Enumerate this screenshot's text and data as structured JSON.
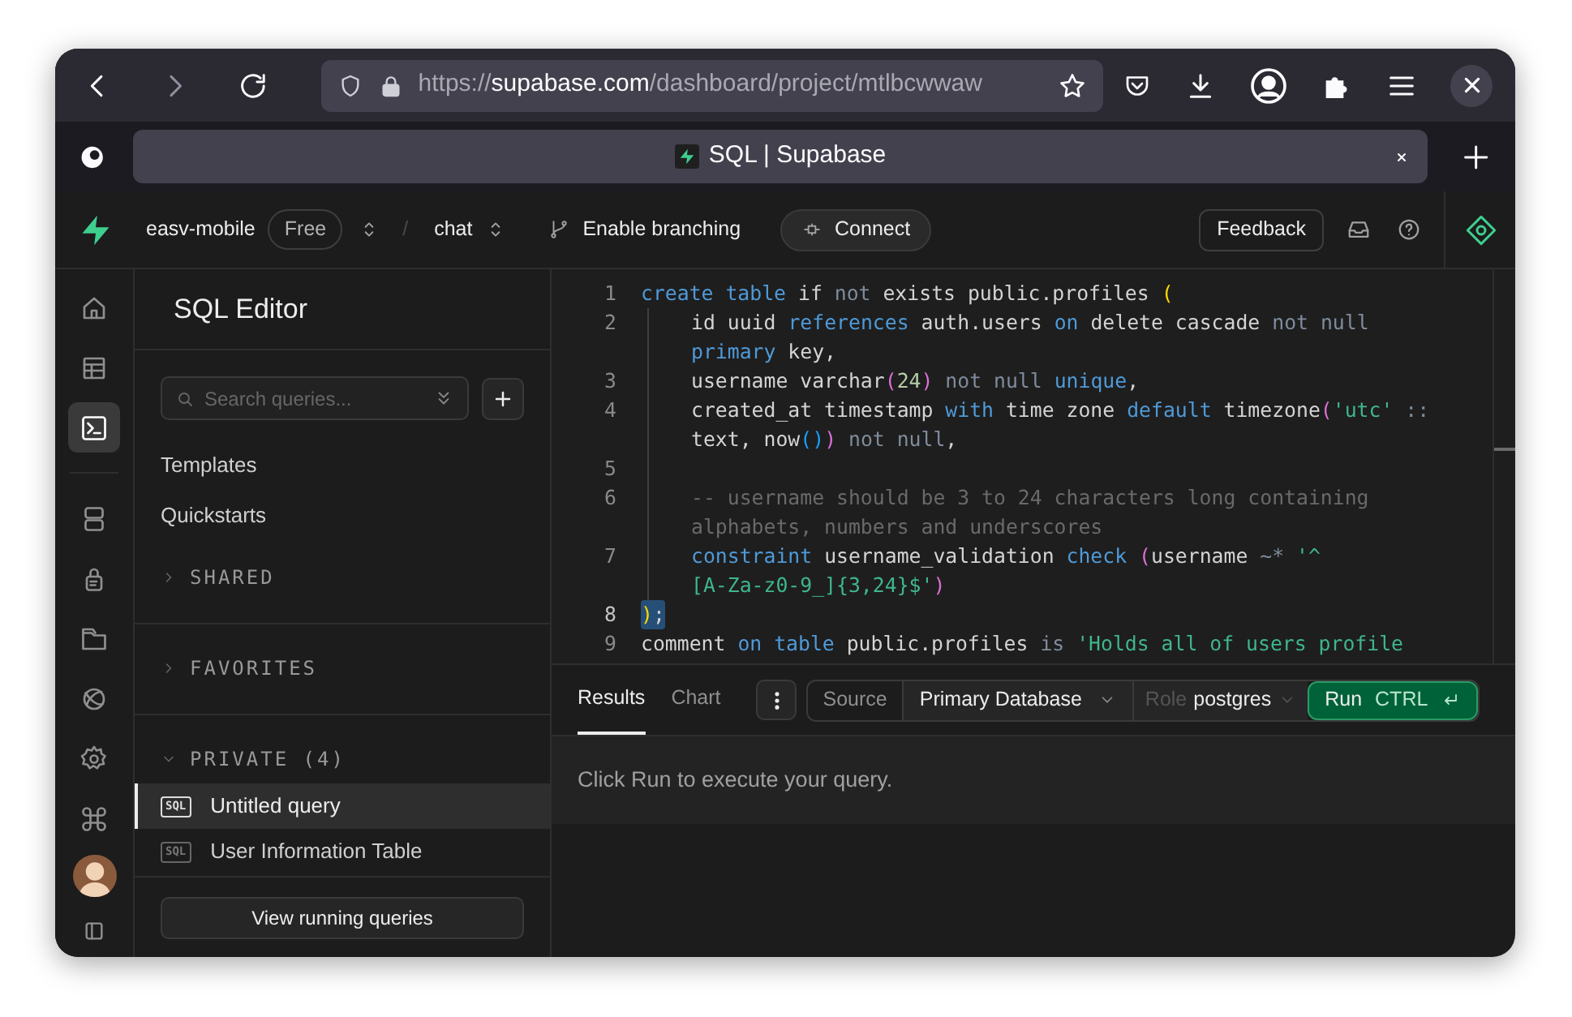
{
  "browser": {
    "url": {
      "scheme": "https://",
      "host": "supabase.com",
      "path": "/dashboard/project/mtlbcwwaw"
    },
    "tab": {
      "title": "SQL | Supabase"
    }
  },
  "header": {
    "project": "easv-mobile",
    "plan": "Free",
    "separator": "/",
    "branch": "chat",
    "branching": "Enable branching",
    "connect": "Connect",
    "feedback": "Feedback"
  },
  "rail_top": [
    {
      "kind": "home",
      "selected": false
    },
    {
      "kind": "table",
      "selected": false
    },
    {
      "kind": "terminal",
      "selected": true
    }
  ],
  "rail": [
    {
      "kind": "database",
      "selected": false
    },
    {
      "kind": "lock",
      "selected": false
    },
    {
      "kind": "folder",
      "selected": false
    },
    {
      "kind": "globe",
      "selected": false
    },
    {
      "kind": "gear",
      "selected": false
    },
    {
      "kind": "command",
      "selected": false
    }
  ],
  "sidebar": {
    "title": "SQL Editor",
    "search": {
      "placeholder": "Search queries..."
    },
    "links": [
      "Templates",
      "Quickstarts"
    ],
    "sections": [
      {
        "label": "SHARED",
        "expanded": false
      },
      {
        "label": "FAVORITES",
        "expanded": false
      },
      {
        "label": "PRIVATE (4)",
        "expanded": true,
        "items": [
          {
            "badge": "SQL",
            "name": "Untitled query",
            "selected": true
          },
          {
            "badge": "SQL",
            "name": "User Information Table",
            "selected": false
          }
        ]
      }
    ],
    "footer_button": "View running queries"
  },
  "editor": {
    "lines": [
      {
        "number": "1",
        "indented": false,
        "selected": false,
        "rows": [
          {
            "tokens": [
              {
                "kind": "keyword",
                "text": "create table"
              },
              {
                "kind": "plain",
                "text": " if "
              },
              {
                "kind": "operator",
                "text": "not"
              },
              {
                "kind": "plain",
                "text": " exists public.profiles "
              },
              {
                "kind": "bracket1",
                "text": "("
              }
            ]
          }
        ]
      },
      {
        "number": "2",
        "indented": true,
        "selected": false,
        "rows": [
          {
            "tokens": [
              {
                "kind": "plain",
                "text": "id uuid "
              },
              {
                "kind": "keyword",
                "text": "references"
              },
              {
                "kind": "plain",
                "text": " auth.users "
              },
              {
                "kind": "keyword",
                "text": "on"
              },
              {
                "kind": "plain",
                "text": " delete cascade "
              },
              {
                "kind": "operator",
                "text": "not null"
              }
            ]
          },
          {
            "tokens": [
              {
                "kind": "keyword",
                "text": "primary"
              },
              {
                "kind": "plain",
                "text": " key,"
              }
            ]
          }
        ]
      },
      {
        "number": "3",
        "indented": true,
        "selected": false,
        "rows": [
          {
            "tokens": [
              {
                "kind": "plain",
                "text": "username varchar"
              },
              {
                "kind": "bracket2",
                "text": "("
              },
              {
                "kind": "number",
                "text": "24"
              },
              {
                "kind": "bracket2",
                "text": ")"
              },
              {
                "kind": "operator",
                "text": " not null"
              },
              {
                "kind": "keyword",
                "text": " unique"
              },
              {
                "kind": "plain",
                "text": ","
              }
            ]
          }
        ]
      },
      {
        "number": "4",
        "indented": true,
        "selected": false,
        "rows": [
          {
            "tokens": [
              {
                "kind": "plain",
                "text": "created_at timestamp "
              },
              {
                "kind": "keyword",
                "text": "with"
              },
              {
                "kind": "plain",
                "text": " time zone "
              },
              {
                "kind": "keyword",
                "text": "default"
              },
              {
                "kind": "plain",
                "text": " timezone"
              },
              {
                "kind": "bracket2",
                "text": "("
              },
              {
                "kind": "string",
                "text": "'utc'"
              },
              {
                "kind": "operator",
                "text": " ::"
              }
            ]
          },
          {
            "tokens": [
              {
                "kind": "plain",
                "text": "text, now"
              },
              {
                "kind": "bracket3",
                "text": "()"
              },
              {
                "kind": "bracket2",
                "text": ")"
              },
              {
                "kind": "operator",
                "text": " not null"
              },
              {
                "kind": "plain",
                "text": ","
              }
            ]
          }
        ]
      },
      {
        "number": "5",
        "indented": true,
        "selected": false
      },
      {
        "number": "6",
        "indented": true,
        "selected": false,
        "rows": [
          {
            "tokens": [
              {
                "kind": "comment",
                "text": "-- username should be 3 to 24 characters long containing"
              }
            ]
          },
          {
            "tokens": [
              {
                "kind": "comment",
                "text": "alphabets, numbers and underscores"
              }
            ]
          }
        ]
      },
      {
        "number": "7",
        "indented": true,
        "selected": false,
        "rows": [
          {
            "tokens": [
              {
                "kind": "keyword",
                "text": "constraint"
              },
              {
                "kind": "plain",
                "text": " username_validation "
              },
              {
                "kind": "keyword",
                "text": "check"
              },
              {
                "kind": "bracket2",
                "text": " ("
              },
              {
                "kind": "plain",
                "text": "username "
              },
              {
                "kind": "operator",
                "text": "~*"
              },
              {
                "kind": "string",
                "text": " '^"
              }
            ]
          },
          {
            "tokens": [
              {
                "kind": "string",
                "text": "[A-Za-z0-9_]{3,24}$'"
              },
              {
                "kind": "bracket2",
                "text": ")"
              }
            ]
          }
        ]
      },
      {
        "number": "8",
        "indented": false,
        "selected": true,
        "rows": [
          {
            "tokens": [
              {
                "kind": "bracket1",
                "text": ")"
              },
              {
                "kind": "plain",
                "text": ";"
              }
            ]
          }
        ]
      },
      {
        "number": "9",
        "indented": false,
        "selected": false,
        "rows": [
          {
            "tokens": [
              {
                "kind": "plain",
                "text": "comment "
              },
              {
                "kind": "keyword",
                "text": "on table"
              },
              {
                "kind": "plain",
                "text": " public.profiles "
              },
              {
                "kind": "operator",
                "text": "is"
              },
              {
                "kind": "string",
                "text": " 'Holds all of users profile"
              }
            ]
          }
        ]
      }
    ]
  },
  "results": {
    "tabs": [
      {
        "label": "Results",
        "selected": true
      },
      {
        "label": "Chart",
        "selected": false
      }
    ],
    "source_label": "Source",
    "database": "Primary Database",
    "role_label": "Role",
    "role": "postgres",
    "run": "Run",
    "shortcut": "CTRL",
    "message": "Click Run to execute your query."
  }
}
